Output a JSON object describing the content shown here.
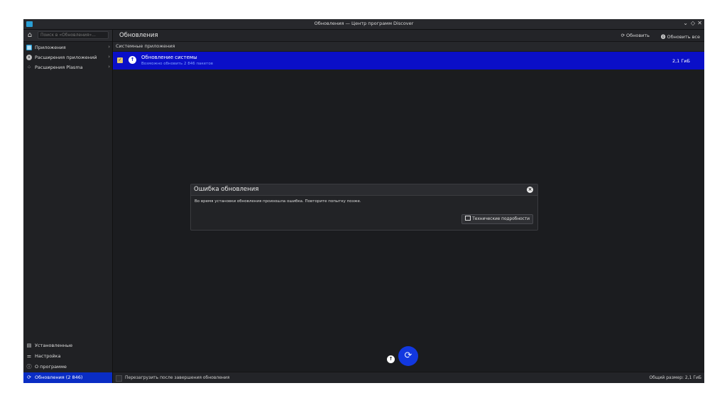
{
  "window": {
    "title": "Обновления — Центр программ Discover",
    "controls": [
      "⌄",
      "◇",
      "✕"
    ]
  },
  "sidebar": {
    "search_placeholder": "Поиск в «Обновления»...",
    "top_items": [
      {
        "label": "Приложения",
        "icon": "grid-icon"
      },
      {
        "label": "Расширения приложений",
        "icon": "puzzle-icon"
      },
      {
        "label": "Расширения Plasma",
        "icon": "plasma-icon"
      }
    ],
    "bottom_items": [
      {
        "label": "Установленные",
        "icon": "installed-icon"
      },
      {
        "label": "Настройка",
        "icon": "settings-icon"
      },
      {
        "label": "О программе",
        "icon": "info-icon"
      },
      {
        "label": "Обновления (2 846)",
        "icon": "updates-icon",
        "active": true
      }
    ]
  },
  "header": {
    "title": "Обновления",
    "refresh_label": "Обновить",
    "update_all_label": "Обновить все"
  },
  "section": {
    "label": "Системные приложения"
  },
  "update_row": {
    "title": "Обновление системы",
    "subtitle": "Возможно обновить 2 846 пакетов",
    "size": "2,1 ГиБ",
    "checked": true
  },
  "dialog": {
    "title": "Ошибка обновления",
    "message": "Во время установки обновления произошла ошибка. Повторите попытку позже.",
    "details_button": "Технические подробности"
  },
  "footer": {
    "restart_label": "Перезагрузить после завершения обновления",
    "total_size": "Общий размер: 2,1 ГиБ"
  },
  "colors": {
    "accent": "#0a2dc4",
    "selected_row": "#0a0fc8",
    "background": "#1b1c1f"
  }
}
